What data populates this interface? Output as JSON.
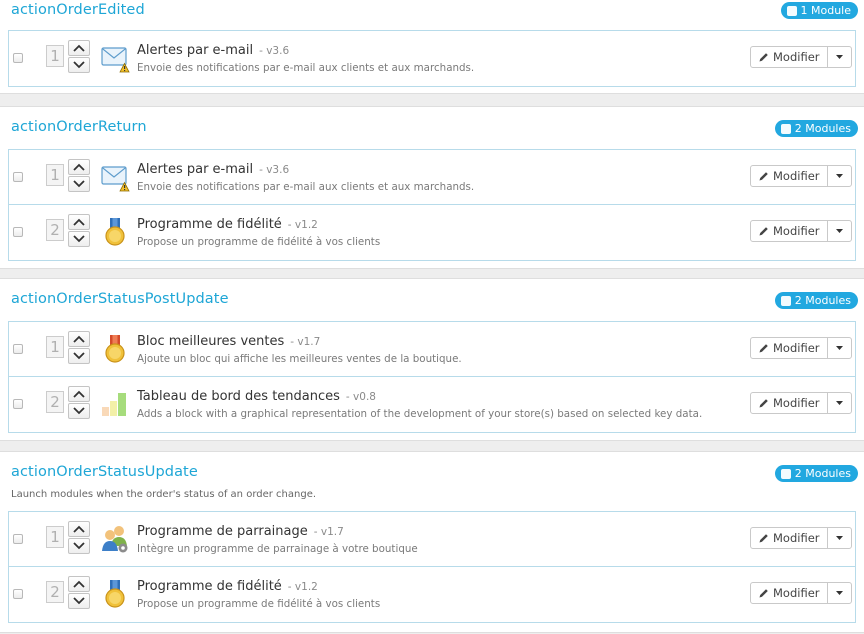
{
  "ui": {
    "edit_label": "Modifier",
    "colors": {
      "accent": "#1ea6d6",
      "badge": "#22a8e0",
      "border": "#b7dbea"
    }
  },
  "hooks": [
    {
      "title": "actionOrderEdited",
      "badge": "1 Module",
      "description": "",
      "modules": [
        {
          "position": "1",
          "icon": "email-warning-icon",
          "name": "Alertes par e-mail",
          "version": "- v3.6",
          "description": "Envoie des notifications par e-mail aux clients et aux marchands."
        }
      ]
    },
    {
      "title": "actionOrderReturn",
      "badge": "2 Modules",
      "description": "",
      "modules": [
        {
          "position": "1",
          "icon": "email-warning-icon",
          "name": "Alertes par e-mail",
          "version": "- v3.6",
          "description": "Envoie des notifications par e-mail aux clients et aux marchands."
        },
        {
          "position": "2",
          "icon": "medal-blue-icon",
          "name": "Programme de fidélité",
          "version": "- v1.2",
          "description": "Propose un programme de fidélité à vos clients"
        }
      ]
    },
    {
      "title": "actionOrderStatusPostUpdate",
      "badge": "2 Modules",
      "description": "",
      "modules": [
        {
          "position": "1",
          "icon": "medal-red-icon",
          "name": "Bloc meilleures ventes",
          "version": "- v1.7",
          "description": "Ajoute un bloc qui affiche les meilleures ventes de la boutique."
        },
        {
          "position": "2",
          "icon": "bar-chart-icon",
          "name": "Tableau de bord des tendances",
          "version": "- v0.8",
          "description": "Adds a block with a graphical representation of the development of your store(s) based on selected key data."
        }
      ]
    },
    {
      "title": "actionOrderStatusUpdate",
      "badge": "2 Modules",
      "description": "Launch modules when the order's status of an order change.",
      "modules": [
        {
          "position": "1",
          "icon": "users-gear-icon",
          "name": "Programme de parrainage",
          "version": "- v1.7",
          "description": "Intègre un programme de parrainage à votre boutique"
        },
        {
          "position": "2",
          "icon": "medal-blue-icon",
          "name": "Programme de fidélité",
          "version": "- v1.2",
          "description": "Propose un programme de fidélité à vos clients"
        }
      ]
    }
  ]
}
